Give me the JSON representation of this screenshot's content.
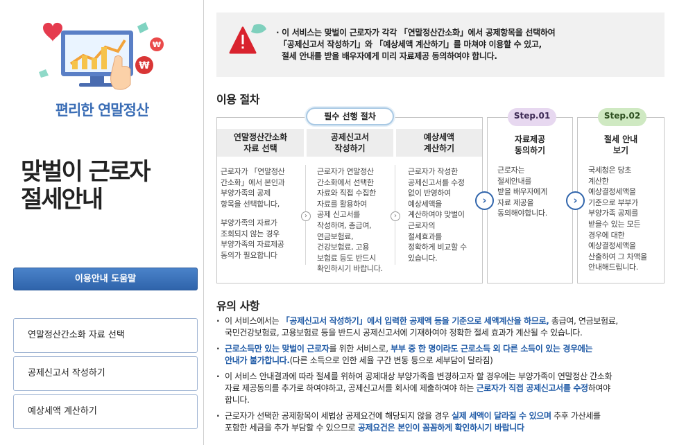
{
  "left": {
    "brand": "편리한 연말정산",
    "title_line1": "맞벌이 근로자",
    "title_line2": "절세안내",
    "help_button": "이용안내 도움말",
    "menu": [
      {
        "label": "연말정산간소화 자료 선택"
      },
      {
        "label": "공제신고서 작성하기"
      },
      {
        "label": "예상세액 계산하기"
      }
    ]
  },
  "notice": {
    "line1": "· 이 서비스는 맞벌이 근로자가 각각 「연말정산간소화」에서 공제항목을 선택하여",
    "line2": "「공제신고서 작성하기」와 「예상세액 계산하기」를 마쳐야 이용할 수 있고,",
    "line3": "절세 안내를 받을 배우자에게 미리 자료제공 동의하여야 합니다."
  },
  "process": {
    "title": "이용 절차",
    "required_label": "필수 선행 절차",
    "steps": [
      {
        "head1": "연말정산간소화",
        "head2": "자료 선택",
        "text": [
          "근로자가 「연말정산",
          "간소화」에서 본인과",
          "부양가족의 공제",
          "항목을 선택합니다,"
        ],
        "text2": [
          "부양가족의 자료가",
          "조회되지 않는 경우",
          "부양가족의 자료제공",
          "동의가 필요합니다"
        ]
      },
      {
        "head1": "공제신고서",
        "head2": "작성하기",
        "text": [
          "근로자가 연말정산",
          "간소화에서 선택한",
          "자료와 직접 수집한",
          "자료를 활용하여",
          "공제 신고서를",
          "작성하며, 총급여,",
          "연금보험료,",
          "건강보험료, 고용",
          "보험료 등도 반드시",
          "확인하시기 바랍니다."
        ]
      },
      {
        "head1": "예상세액",
        "head2": "계산하기",
        "text": [
          "근로자가 작성한",
          "공제신고서를 수정",
          "없이 반영하여",
          "예상세액을",
          "계산하여야  맞벌이",
          "근로자의",
          "절세효과를",
          "정확하게 비교할 수",
          "있습니다."
        ]
      }
    ],
    "step1": {
      "badge": "Step.01",
      "head1": "자료제공",
      "head2": "동의하기",
      "text": [
        "근로자는",
        "절세안내를",
        "받을 배우자에게",
        "자료 제공을",
        "동의해야합니다."
      ]
    },
    "step2": {
      "badge": "Step.02",
      "head1": "절세 안내",
      "head2": "보기",
      "text": [
        "국세청은 당초",
        "계산한",
        "예상결정세액을",
        "기준으로 부부가",
        "부양가족 공제를",
        "받을수 있는 모든",
        "경우에 대한",
        "예상결정세액을",
        "산출하여 그 차액을",
        "안내해드립니다."
      ]
    }
  },
  "cautions": {
    "title": "유의 사항",
    "i1a_pre": "이 서비스에서는 ",
    "i1a_hl": "「공제신고서 작성하기」에서 입력한 공제액 등을 기준으로 세액계산을 하므로,",
    "i1a_post": " 총급여, 연금보험료,",
    "i1b": "국민건강보험료, 고용보험료 등을 반드시 공제신고서에 기재하여야 정확한 절세 효과가 계산될 수 있습니다.",
    "i2a_hl1": "근로소득만 있는 맞벌이 근로자",
    "i2a_mid": "를 위한 서비스로, ",
    "i2a_hl2": "부부 중 한 명이라도 근로소득 외 다른 소득이  있는 경우에는",
    "i2b_hl": "안내가 불가합니다.",
    "i2b_post": "(다른 소득으로 인한 세율 구간 변동 등으로 세부담이 달라짐)",
    "i3a": "이 서비스 안내결과에 따라 절세를 위하여 공제대상 부양가족을 변경하고자 할 경우에는 부양가족이 연말정산 간소화",
    "i3b_pre": "자료 제공동의를 추가로 하여야하고, 공제신고서를 회사에 제출하여야 하는 ",
    "i3b_hl": "근로자가 직접 공제신고서를 수정",
    "i3b_post": "하여야",
    "i3c": "합니다.",
    "i4a_pre": "근로자가 선택한 공제항목이 세법상 공제요건에 해당되지 않을 경우 ",
    "i4a_hl": "실제 세액이 달라질 수 있으며",
    "i4a_post": " 추후 가산세를",
    "i4b_pre": "포함한 세금을 추가 부담할 수 있으므로 ",
    "i4b_hl": "공제요건은 본인이 꼼꼼하게 확인하시기 바랍니다"
  },
  "colors": {
    "accent": "#2f64ab",
    "highlight": "#1f5aa6",
    "brand": "#3a6db5",
    "warn": "#d9232e"
  }
}
